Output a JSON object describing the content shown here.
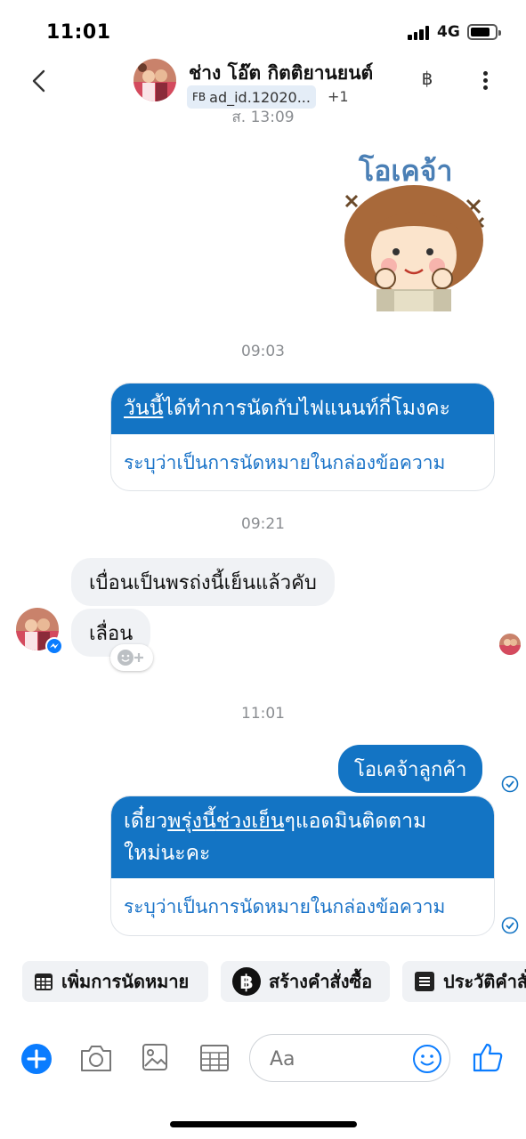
{
  "status_bar": {
    "time": "11:01",
    "network": "4G"
  },
  "header": {
    "contact_name": "ช่าง โอ๊ต กิตติยานยนต์",
    "ad_badge": "FB",
    "ad_id": "ad_id.12020...",
    "extra_count": "+1",
    "currency_icon": "฿"
  },
  "messages": {
    "cut_timestamp": "ส. 13:09",
    "sticker_text": "โอเคจ้า",
    "ts_1": "09:03",
    "card_1": {
      "underlined": "วันนี้",
      "rest": "ได้ทำการนัดกับไฟแนนท์กี่โมงคะ",
      "action": "ระบุว่าเป็นการนัดหมายในกล่องข้อความ"
    },
    "ts_2": "09:21",
    "incoming_1": "เบื่อนเป็นพรถ่งนี้เย็นแล้วคับ",
    "incoming_2": "เลื่อน",
    "ts_3": "11:01",
    "outgoing_1": "โอเคจ้าลูกค้า",
    "card_2": {
      "part_a": "เดี๋ยว",
      "part_b": "พรุ่งนี้",
      "part_c": "ช่วงเย็น",
      "part_d": "ๆแอดมินติดตาม",
      "line2": "ใหม่นะคะ",
      "action": "ระบุว่าเป็นการนัดหมายในกล่องข้อความ"
    }
  },
  "quick_actions": [
    {
      "label": "เพิ่มการนัดหมาย",
      "icon": "calendar-icon"
    },
    {
      "label": "สร้างคำสั่งซื้อ",
      "icon": "baht-icon"
    },
    {
      "label": "ประวัติคำสั่งซื้อ",
      "icon": "list-icon"
    }
  ],
  "composer": {
    "placeholder": "Aa"
  },
  "colors": {
    "accent": "#1374c4",
    "messenger_blue": "#0a7cff",
    "bubble_gray": "#f0f2f5"
  }
}
